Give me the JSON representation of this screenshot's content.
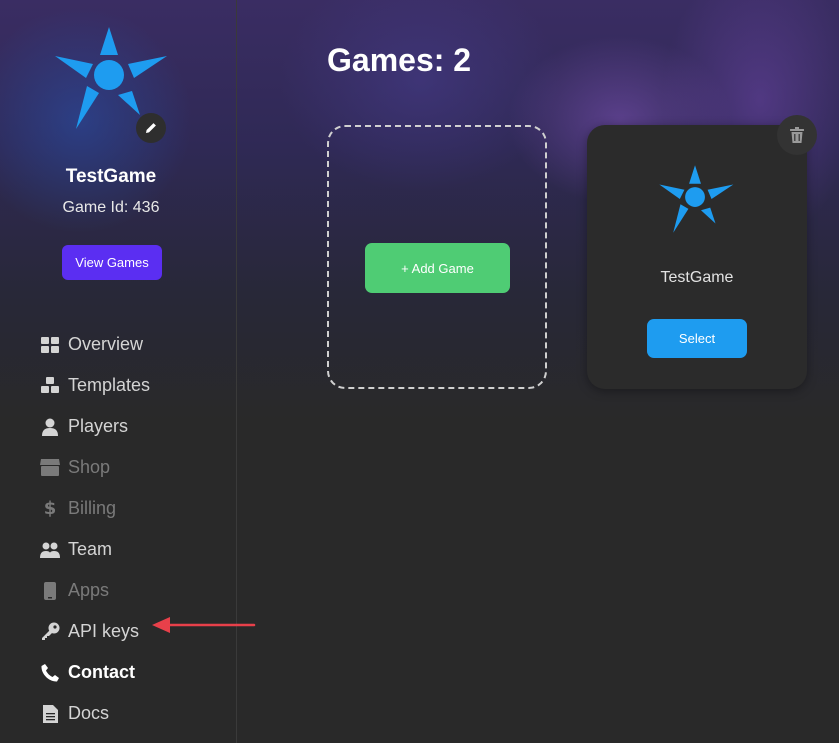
{
  "sidebar": {
    "game_name": "TestGame",
    "game_id": "Game Id: 436",
    "view_games_label": "View Games",
    "nav": [
      {
        "label": "Overview",
        "icon": "grid-icon"
      },
      {
        "label": "Templates",
        "icon": "cubes-icon"
      },
      {
        "label": "Players",
        "icon": "user-icon"
      },
      {
        "label": "Shop",
        "icon": "store-icon"
      },
      {
        "label": "Billing",
        "icon": "dollar-icon"
      },
      {
        "label": "Team",
        "icon": "users-icon"
      },
      {
        "label": "Apps",
        "icon": "phone-icon"
      },
      {
        "label": "API keys",
        "icon": "key-icon"
      },
      {
        "label": "Contact",
        "icon": "telephone-icon"
      },
      {
        "label": "Docs",
        "icon": "document-icon"
      }
    ]
  },
  "main": {
    "heading": "Games: 2",
    "add_game_label": "+ Add Game",
    "games": [
      {
        "name": "TestGame",
        "select_label": "Select"
      }
    ]
  },
  "colors": {
    "accent_purple": "#5b2ef2",
    "add_green": "#4fcc74",
    "select_blue": "#1e9cf0",
    "logo_blue": "#1e9cf0",
    "annotation_arrow": "#e8404a"
  }
}
